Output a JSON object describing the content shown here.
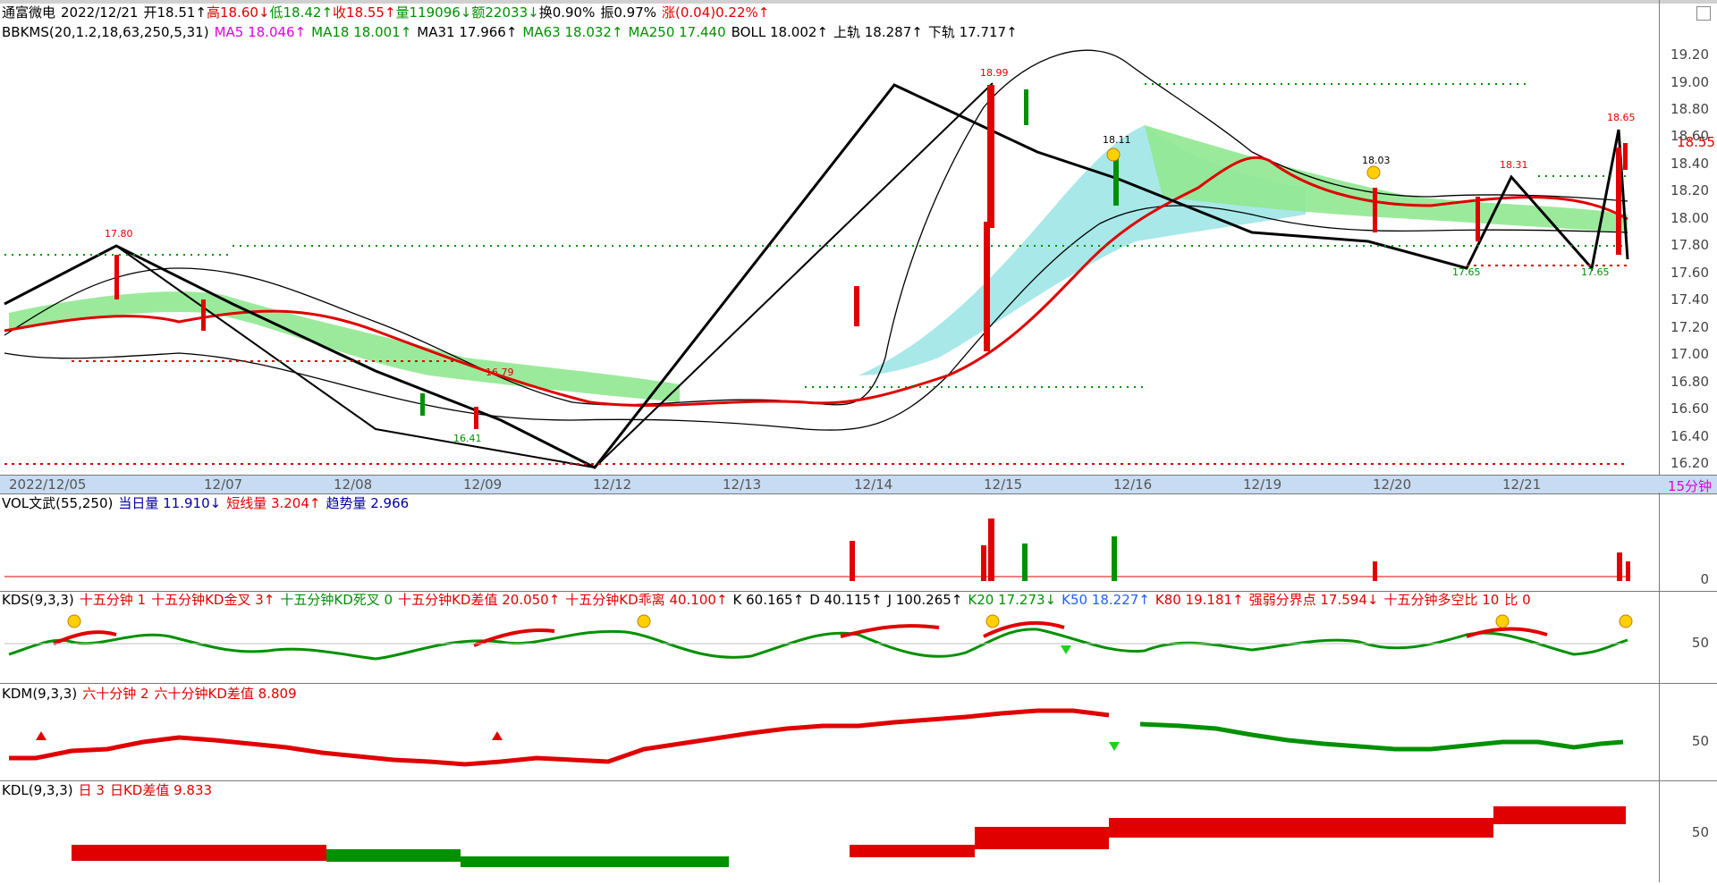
{
  "header": {
    "stock_name": "通富微电",
    "date": "2022/12/21",
    "open": "开18.51↑",
    "high": "高18.60↓",
    "low": "低18.42↑",
    "close": "收18.55↑",
    "volume": "量119096↓",
    "amount": "额22033↓",
    "turnover": "换0.90%",
    "amplitude": "振0.97%",
    "change": "涨(0.04)0.22%↑"
  },
  "indicator_line": {
    "name": "BBKMS(20,1.2,18,63,250,5,31)",
    "ma5": "MA5 18.046↑",
    "ma18": "MA18 18.001↑",
    "ma31": "MA31 17.966↑",
    "ma63": "MA63 18.032↑",
    "ma250": "MA250 17.440",
    "boll": "BOLL 18.002↑",
    "upper": "上轨 18.287↑",
    "lower": "下轨 17.717↑"
  },
  "price_axis": [
    "19.20",
    "19.00",
    "18.80",
    "18.60",
    "18.40",
    "18.20",
    "18.00",
    "17.80",
    "17.60",
    "17.40",
    "17.20",
    "17.00",
    "16.80",
    "16.60",
    "16.40",
    "16.20"
  ],
  "current_price": "18.55",
  "annotations": {
    "high_1": "17.80",
    "high_2": "18.99",
    "high_3": "18.03",
    "high_4": "18.31",
    "high_5": "18.65",
    "low_1": "16.41",
    "low_2": "17.65",
    "low_3": "17.65",
    "mid_1": "18.11",
    "mid_2": "16.79"
  },
  "date_axis": [
    "2022/12/05",
    "12/07",
    "12/08",
    "12/09",
    "12/12",
    "12/13",
    "12/14",
    "12/15",
    "12/16",
    "12/19",
    "12/20",
    "12/21"
  ],
  "period": "15分钟",
  "vol_panel": {
    "name": "VOL文武(55,250)",
    "day_vol": "当日量 11.910↓",
    "short": "短线量 3.204↑",
    "trend": "趋势量 2.966",
    "axis_zero": "0"
  },
  "kds_panel": {
    "name": "KDS(9,3,3)",
    "a": "十五分钟 1",
    "b": "十五分钟KD金叉 3↑",
    "c": "十五分钟KD死叉 0",
    "d": "十五分钟KD差值 20.050↑",
    "e": "十五分钟KD乖离 40.100↑",
    "k": "K 60.165↑",
    "dv": "D 40.115↑",
    "j": "J 100.265↑",
    "k20": "K20 17.273↓",
    "k50": "K50 18.227↑",
    "k80": "K80 19.181↑",
    "boundary": "强弱分界点 17.594↓",
    "ratio": "十五分钟多空比 10",
    "bi": "比 0",
    "axis_50": "50"
  },
  "kdm_panel": {
    "name": "KDM(9,3,3)",
    "a": "六十分钟 2",
    "b": "六十分钟KD差值 8.809",
    "axis_50": "50"
  },
  "kdl_panel": {
    "name": "KDL(9,3,3)",
    "a": "日 3",
    "b": "日KD差值 9.833",
    "axis_50": "50"
  },
  "colors": {
    "up": "#e00000",
    "down": "#009000",
    "cloud_green": "#90e890",
    "cloud_cyan": "#a8e8e8",
    "date_bar": "#c7dcf2"
  }
}
